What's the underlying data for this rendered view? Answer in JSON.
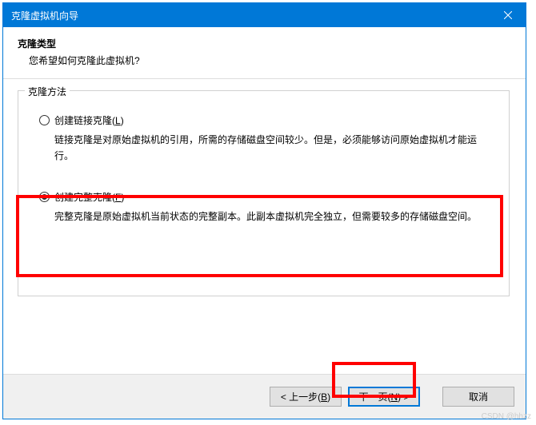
{
  "titlebar": {
    "title": "克隆虚拟机向导"
  },
  "header": {
    "title": "克隆类型",
    "subtitle": "您希望如何克隆此虚拟机?"
  },
  "fieldset": {
    "legend": "克隆方法"
  },
  "option1": {
    "label_prefix": "创建链接克隆(",
    "label_key": "L",
    "label_suffix": ")",
    "desc": "链接克隆是对原始虚拟机的引用，所需的存储磁盘空间较少。但是，必须能够访问原始虚拟机才能运行。",
    "checked": false
  },
  "option2": {
    "label_prefix": "创建完整克隆(",
    "label_key": "F",
    "label_suffix": ")",
    "desc": "完整克隆是原始虚拟机当前状态的完整副本。此副本虚拟机完全独立，但需要较多的存储磁盘空间。",
    "checked": true
  },
  "buttons": {
    "back_prefix": "< 上一步(",
    "back_key": "B",
    "back_suffix": ")",
    "next_prefix": "下一页(",
    "next_key": "N",
    "next_suffix": ") >",
    "cancel": "取消"
  },
  "watermark": "CSDN @hhzz"
}
